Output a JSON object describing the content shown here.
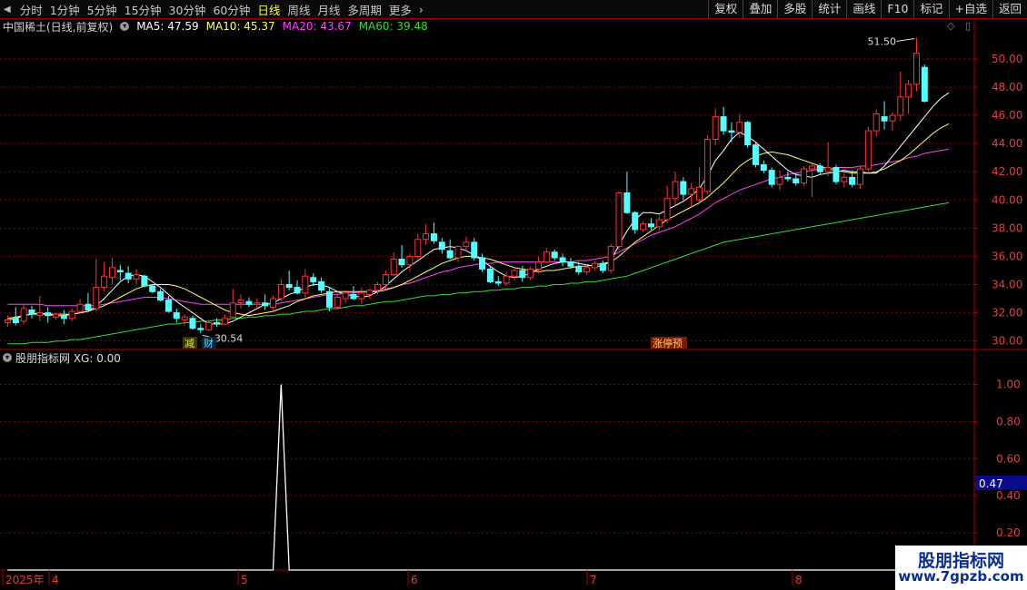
{
  "toolbar": {
    "periods": [
      "分时",
      "1分钟",
      "5分钟",
      "15分钟",
      "30分钟",
      "60分钟",
      "日线",
      "周线",
      "月线",
      "多周期",
      "更多"
    ],
    "active_period": "日线",
    "more_arrow": "›",
    "right_buttons": [
      "复权",
      "叠加",
      "多股",
      "统计",
      "画线",
      "F10",
      "标记",
      "+自选",
      "返回"
    ]
  },
  "info": {
    "stock_name": "中国稀土(日线,前复权)",
    "ma5": "MA5: 47.59",
    "ma10": "MA10: 45.37",
    "ma20": "MA20: 43.67",
    "ma60": "MA60: 39.48"
  },
  "colors": {
    "up": "#ff3232",
    "down": "#54ffff",
    "ma5": "#ffffff",
    "ma10": "#ffff66",
    "ma20": "#ff40ff",
    "ma60": "#33dd33",
    "grid": "#8a0000",
    "axis": "#b00000",
    "indicator_line": "#ffffff"
  },
  "price_chart": {
    "y_ticks": [
      "50.00",
      "48.00",
      "46.00",
      "44.00",
      "42.00",
      "40.00",
      "38.00",
      "36.00",
      "34.00",
      "32.00",
      "30.00"
    ],
    "max_label": "51.50",
    "min_label": "30.54",
    "event_tags": [
      "减",
      "财",
      "涨停预"
    ]
  },
  "indicator": {
    "title": "股朋指标网 XG: 0.00",
    "y_ticks": [
      "1.00",
      "0.80",
      "0.60",
      "0.40",
      "0.20"
    ],
    "cursor_value": "0.47"
  },
  "time_axis": {
    "labels": [
      "2025年",
      "4",
      "5",
      "6",
      "7",
      "8"
    ]
  },
  "watermark": {
    "line1": "股朋指标网",
    "line2": "www.7gpzb.com"
  },
  "chart_data": {
    "type": "candlestick",
    "title": "中国稀土(日线,前复权)",
    "ylim": [
      29.4,
      51.6
    ],
    "candles": [
      {
        "o": 31.3,
        "h": 31.8,
        "l": 31.0,
        "c": 31.5
      },
      {
        "o": 31.6,
        "h": 32.4,
        "l": 31.1,
        "c": 31.3
      },
      {
        "o": 31.4,
        "h": 32.6,
        "l": 31.2,
        "c": 32.3
      },
      {
        "o": 32.2,
        "h": 32.5,
        "l": 31.6,
        "c": 31.9
      },
      {
        "o": 31.8,
        "h": 33.2,
        "l": 31.4,
        "c": 32.0
      },
      {
        "o": 32.0,
        "h": 32.4,
        "l": 31.3,
        "c": 31.8
      },
      {
        "o": 31.7,
        "h": 32.0,
        "l": 31.5,
        "c": 31.9
      },
      {
        "o": 31.8,
        "h": 32.2,
        "l": 31.2,
        "c": 31.6
      },
      {
        "o": 31.6,
        "h": 32.3,
        "l": 31.4,
        "c": 32.1
      },
      {
        "o": 32.1,
        "h": 33.0,
        "l": 31.9,
        "c": 32.6
      },
      {
        "o": 32.6,
        "h": 33.4,
        "l": 32.4,
        "c": 32.2
      },
      {
        "o": 32.3,
        "h": 35.8,
        "l": 32.1,
        "c": 33.8
      },
      {
        "o": 33.8,
        "h": 35.6,
        "l": 33.5,
        "c": 34.6
      },
      {
        "o": 34.5,
        "h": 35.9,
        "l": 34.0,
        "c": 35.2
      },
      {
        "o": 35.0,
        "h": 35.4,
        "l": 34.3,
        "c": 34.9
      },
      {
        "o": 34.8,
        "h": 35.3,
        "l": 34.1,
        "c": 34.4
      },
      {
        "o": 34.4,
        "h": 35.1,
        "l": 34.0,
        "c": 34.7
      },
      {
        "o": 34.6,
        "h": 34.7,
        "l": 33.8,
        "c": 33.9
      },
      {
        "o": 33.9,
        "h": 34.0,
        "l": 33.4,
        "c": 33.5
      },
      {
        "o": 33.5,
        "h": 33.7,
        "l": 32.8,
        "c": 32.9
      },
      {
        "o": 32.9,
        "h": 33.2,
        "l": 32.0,
        "c": 32.1
      },
      {
        "o": 32.0,
        "h": 32.3,
        "l": 31.3,
        "c": 31.6
      },
      {
        "o": 31.5,
        "h": 31.9,
        "l": 31.1,
        "c": 31.7
      },
      {
        "o": 31.6,
        "h": 31.8,
        "l": 30.8,
        "c": 30.9
      },
      {
        "o": 30.9,
        "h": 31.2,
        "l": 30.54,
        "c": 30.8
      },
      {
        "o": 30.8,
        "h": 31.5,
        "l": 30.7,
        "c": 31.3
      },
      {
        "o": 31.3,
        "h": 31.6,
        "l": 31.0,
        "c": 31.2
      },
      {
        "o": 31.2,
        "h": 31.9,
        "l": 31.1,
        "c": 31.6
      },
      {
        "o": 31.7,
        "h": 33.7,
        "l": 31.7,
        "c": 32.7
      },
      {
        "o": 32.7,
        "h": 33.3,
        "l": 32.3,
        "c": 32.9
      },
      {
        "o": 32.8,
        "h": 33.1,
        "l": 32.4,
        "c": 32.6
      },
      {
        "o": 32.6,
        "h": 33.0,
        "l": 32.3,
        "c": 32.7
      },
      {
        "o": 32.7,
        "h": 33.3,
        "l": 32.2,
        "c": 32.5
      },
      {
        "o": 32.4,
        "h": 33.2,
        "l": 32.2,
        "c": 33.0
      },
      {
        "o": 33.0,
        "h": 34.4,
        "l": 32.8,
        "c": 34.0
      },
      {
        "o": 34.0,
        "h": 35.0,
        "l": 33.6,
        "c": 33.8
      },
      {
        "o": 33.8,
        "h": 34.3,
        "l": 33.3,
        "c": 33.4
      },
      {
        "o": 33.4,
        "h": 35.1,
        "l": 33.1,
        "c": 34.6
      },
      {
        "o": 34.5,
        "h": 34.8,
        "l": 33.9,
        "c": 34.2
      },
      {
        "o": 34.2,
        "h": 34.5,
        "l": 33.4,
        "c": 33.6
      },
      {
        "o": 33.5,
        "h": 33.8,
        "l": 32.1,
        "c": 32.4
      },
      {
        "o": 32.4,
        "h": 33.5,
        "l": 32.2,
        "c": 33.1
      },
      {
        "o": 33.0,
        "h": 33.6,
        "l": 32.7,
        "c": 33.4
      },
      {
        "o": 33.3,
        "h": 33.9,
        "l": 32.9,
        "c": 33.0
      },
      {
        "o": 33.0,
        "h": 33.8,
        "l": 32.6,
        "c": 33.4
      },
      {
        "o": 33.3,
        "h": 33.7,
        "l": 33.0,
        "c": 33.6
      },
      {
        "o": 33.6,
        "h": 34.2,
        "l": 33.3,
        "c": 34.0
      },
      {
        "o": 34.0,
        "h": 35.0,
        "l": 33.7,
        "c": 34.7
      },
      {
        "o": 34.7,
        "h": 36.3,
        "l": 34.6,
        "c": 35.8
      },
      {
        "o": 35.8,
        "h": 36.8,
        "l": 35.2,
        "c": 35.4
      },
      {
        "o": 35.4,
        "h": 36.2,
        "l": 34.9,
        "c": 36.0
      },
      {
        "o": 36.0,
        "h": 37.6,
        "l": 35.8,
        "c": 37.2
      },
      {
        "o": 37.2,
        "h": 38.3,
        "l": 36.8,
        "c": 37.6
      },
      {
        "o": 37.6,
        "h": 38.4,
        "l": 36.9,
        "c": 37.1
      },
      {
        "o": 37.0,
        "h": 37.3,
        "l": 36.2,
        "c": 36.5
      },
      {
        "o": 36.4,
        "h": 37.2,
        "l": 35.8,
        "c": 35.9
      },
      {
        "o": 35.9,
        "h": 36.8,
        "l": 35.6,
        "c": 36.7
      },
      {
        "o": 36.7,
        "h": 37.4,
        "l": 36.4,
        "c": 37.0
      },
      {
        "o": 37.0,
        "h": 37.3,
        "l": 35.7,
        "c": 35.9
      },
      {
        "o": 35.9,
        "h": 36.2,
        "l": 34.9,
        "c": 35.1
      },
      {
        "o": 35.1,
        "h": 35.3,
        "l": 34.1,
        "c": 34.2
      },
      {
        "o": 34.2,
        "h": 34.6,
        "l": 33.9,
        "c": 34.1
      },
      {
        "o": 34.1,
        "h": 34.9,
        "l": 33.9,
        "c": 34.6
      },
      {
        "o": 34.6,
        "h": 35.3,
        "l": 34.3,
        "c": 35.0
      },
      {
        "o": 35.0,
        "h": 35.3,
        "l": 34.2,
        "c": 34.5
      },
      {
        "o": 34.5,
        "h": 35.3,
        "l": 34.3,
        "c": 35.1
      },
      {
        "o": 35.1,
        "h": 36.0,
        "l": 34.8,
        "c": 35.6
      },
      {
        "o": 35.6,
        "h": 36.6,
        "l": 35.5,
        "c": 36.3
      },
      {
        "o": 36.3,
        "h": 36.5,
        "l": 35.7,
        "c": 35.9
      },
      {
        "o": 35.9,
        "h": 36.2,
        "l": 35.3,
        "c": 35.6
      },
      {
        "o": 35.6,
        "h": 35.9,
        "l": 35.1,
        "c": 35.3
      },
      {
        "o": 35.3,
        "h": 35.6,
        "l": 34.7,
        "c": 34.9
      },
      {
        "o": 34.9,
        "h": 35.4,
        "l": 34.7,
        "c": 35.2
      },
      {
        "o": 35.2,
        "h": 35.7,
        "l": 35.0,
        "c": 35.5
      },
      {
        "o": 35.5,
        "h": 35.7,
        "l": 34.8,
        "c": 35.0
      },
      {
        "o": 35.0,
        "h": 36.9,
        "l": 34.8,
        "c": 36.7
      },
      {
        "o": 36.7,
        "h": 40.6,
        "l": 36.4,
        "c": 40.5
      },
      {
        "o": 40.5,
        "h": 42.0,
        "l": 39.0,
        "c": 39.1
      },
      {
        "o": 39.1,
        "h": 39.2,
        "l": 37.6,
        "c": 37.9
      },
      {
        "o": 37.9,
        "h": 38.5,
        "l": 37.7,
        "c": 38.3
      },
      {
        "o": 38.3,
        "h": 38.7,
        "l": 37.9,
        "c": 38.1
      },
      {
        "o": 38.1,
        "h": 38.9,
        "l": 37.8,
        "c": 38.6
      },
      {
        "o": 38.6,
        "h": 41.0,
        "l": 38.4,
        "c": 40.1
      },
      {
        "o": 40.1,
        "h": 42.0,
        "l": 39.6,
        "c": 41.3
      },
      {
        "o": 41.3,
        "h": 41.6,
        "l": 40.0,
        "c": 40.4
      },
      {
        "o": 40.4,
        "h": 41.2,
        "l": 39.5,
        "c": 40.8
      },
      {
        "o": 40.0,
        "h": 42.3,
        "l": 39.7,
        "c": 40.9
      },
      {
        "o": 40.6,
        "h": 44.6,
        "l": 40.4,
        "c": 44.3
      },
      {
        "o": 44.3,
        "h": 46.5,
        "l": 43.9,
        "c": 45.9
      },
      {
        "o": 45.9,
        "h": 46.6,
        "l": 44.6,
        "c": 44.9
      },
      {
        "o": 44.9,
        "h": 45.5,
        "l": 44.1,
        "c": 44.8
      },
      {
        "o": 44.8,
        "h": 46.1,
        "l": 44.4,
        "c": 45.5
      },
      {
        "o": 45.5,
        "h": 45.6,
        "l": 43.7,
        "c": 43.9
      },
      {
        "o": 43.9,
        "h": 44.1,
        "l": 42.3,
        "c": 42.5
      },
      {
        "o": 42.5,
        "h": 42.8,
        "l": 41.9,
        "c": 42.1
      },
      {
        "o": 42.1,
        "h": 42.3,
        "l": 40.9,
        "c": 41.1
      },
      {
        "o": 41.1,
        "h": 42.1,
        "l": 40.7,
        "c": 41.6
      },
      {
        "o": 41.6,
        "h": 42.0,
        "l": 41.3,
        "c": 41.5
      },
      {
        "o": 41.5,
        "h": 41.9,
        "l": 41.0,
        "c": 41.2
      },
      {
        "o": 41.2,
        "h": 42.4,
        "l": 41.0,
        "c": 42.2
      },
      {
        "o": 42.2,
        "h": 42.6,
        "l": 40.2,
        "c": 42.4
      },
      {
        "o": 42.4,
        "h": 42.6,
        "l": 41.8,
        "c": 42.0
      },
      {
        "o": 42.0,
        "h": 44.1,
        "l": 41.7,
        "c": 42.3
      },
      {
        "o": 42.3,
        "h": 42.5,
        "l": 41.1,
        "c": 41.3
      },
      {
        "o": 41.3,
        "h": 41.9,
        "l": 40.9,
        "c": 41.6
      },
      {
        "o": 41.6,
        "h": 42.1,
        "l": 40.9,
        "c": 41.1
      },
      {
        "o": 41.1,
        "h": 42.4,
        "l": 40.8,
        "c": 42.2
      },
      {
        "o": 42.2,
        "h": 45.2,
        "l": 41.9,
        "c": 44.9
      },
      {
        "o": 44.9,
        "h": 46.4,
        "l": 44.5,
        "c": 46.1
      },
      {
        "o": 45.9,
        "h": 47.0,
        "l": 45.0,
        "c": 45.6
      },
      {
        "o": 45.6,
        "h": 46.2,
        "l": 44.9,
        "c": 46.0
      },
      {
        "o": 46.0,
        "h": 49.1,
        "l": 45.6,
        "c": 47.3
      },
      {
        "o": 47.3,
        "h": 48.5,
        "l": 46.1,
        "c": 48.2
      },
      {
        "o": 48.2,
        "h": 51.5,
        "l": 47.7,
        "c": 50.4
      },
      {
        "o": 49.4,
        "h": 49.6,
        "l": 46.9,
        "c": 47.0
      }
    ],
    "ma5": [
      31.5,
      31.6,
      31.8,
      31.9,
      32.0,
      31.9,
      31.8,
      31.8,
      31.9,
      32.0,
      32.1,
      32.5,
      33.0,
      33.6,
      34.2,
      34.6,
      34.7,
      34.6,
      34.2,
      33.8,
      33.3,
      32.8,
      32.4,
      32.0,
      31.6,
      31.2,
      31.2,
      31.2,
      31.4,
      31.7,
      32.0,
      32.3,
      32.6,
      32.7,
      33.0,
      33.3,
      33.5,
      33.8,
      34.0,
      34.0,
      33.8,
      33.5,
      33.3,
      33.2,
      33.1,
      33.2,
      33.5,
      33.9,
      34.4,
      34.9,
      35.3,
      35.7,
      36.1,
      36.5,
      36.6,
      36.7,
      36.6,
      36.4,
      36.1,
      35.7,
      35.3,
      34.9,
      34.6,
      34.5,
      34.6,
      34.8,
      35.1,
      35.3,
      35.5,
      35.6,
      35.6,
      35.5,
      35.4,
      35.3,
      35.3,
      35.7,
      36.8,
      37.8,
      38.6,
      39.1,
      39.1,
      39.0,
      39.3,
      39.6,
      39.9,
      40.3,
      40.8,
      41.7,
      42.8,
      43.5,
      44.3,
      44.8,
      44.5,
      44.1,
      43.6,
      43.1,
      42.6,
      42.1,
      41.8,
      41.7,
      41.6,
      41.8,
      41.9,
      42.0,
      42.1,
      42.0,
      42.0,
      41.9,
      41.9,
      42.4,
      43.1,
      43.8,
      44.5,
      45.2,
      45.9,
      46.6,
      47.2,
      47.6
    ],
    "ma10": [
      31.6,
      31.7,
      31.8,
      31.9,
      31.9,
      31.9,
      31.9,
      31.9,
      31.9,
      32.0,
      32.1,
      32.3,
      32.5,
      32.8,
      33.1,
      33.4,
      33.7,
      33.9,
      34.0,
      34.0,
      34.0,
      33.9,
      33.7,
      33.4,
      33.1,
      32.8,
      32.5,
      32.2,
      32.0,
      31.9,
      31.8,
      31.9,
      32.0,
      32.1,
      32.3,
      32.5,
      32.8,
      33.0,
      33.2,
      33.3,
      33.4,
      33.5,
      33.5,
      33.5,
      33.5,
      33.5,
      33.5,
      33.6,
      33.8,
      34.0,
      34.3,
      34.6,
      34.9,
      35.2,
      35.5,
      35.7,
      35.9,
      36.0,
      36.0,
      35.9,
      35.8,
      35.6,
      35.4,
      35.2,
      35.1,
      35.0,
      34.9,
      35.0,
      35.0,
      35.1,
      35.2,
      35.3,
      35.3,
      35.4,
      35.5,
      35.6,
      36.0,
      36.5,
      37.0,
      37.4,
      37.8,
      38.2,
      38.6,
      38.9,
      39.2,
      39.5,
      39.8,
      40.2,
      40.7,
      41.2,
      41.8,
      42.4,
      42.8,
      43.1,
      43.3,
      43.4,
      43.3,
      43.2,
      43.0,
      42.8,
      42.6,
      42.4,
      42.2,
      42.1,
      42.0,
      41.9,
      41.9,
      41.9,
      42.0,
      42.2,
      42.5,
      42.8,
      43.2,
      43.7,
      44.2,
      44.7,
      45.1,
      45.4
    ],
    "ma20": [
      32.6,
      32.6,
      32.6,
      32.6,
      32.6,
      32.5,
      32.5,
      32.5,
      32.5,
      32.5,
      32.5,
      32.5,
      32.6,
      32.7,
      32.8,
      32.9,
      33.0,
      33.1,
      33.1,
      33.1,
      33.0,
      32.9,
      32.8,
      32.7,
      32.6,
      32.6,
      32.6,
      32.6,
      32.6,
      32.6,
      32.6,
      32.6,
      32.6,
      32.6,
      32.7,
      32.8,
      32.9,
      33.0,
      33.1,
      33.2,
      33.3,
      33.3,
      33.4,
      33.4,
      33.5,
      33.5,
      33.6,
      33.7,
      33.8,
      34.0,
      34.1,
      34.3,
      34.5,
      34.7,
      34.9,
      35.0,
      35.2,
      35.3,
      35.4,
      35.5,
      35.5,
      35.6,
      35.6,
      35.6,
      35.6,
      35.6,
      35.6,
      35.6,
      35.6,
      35.6,
      35.6,
      35.7,
      35.7,
      35.8,
      35.9,
      36.0,
      36.3,
      36.6,
      36.9,
      37.2,
      37.5,
      37.7,
      37.9,
      38.1,
      38.4,
      38.7,
      39.0,
      39.4,
      39.8,
      40.1,
      40.4,
      40.7,
      40.9,
      41.1,
      41.3,
      41.5,
      41.6,
      41.8,
      41.9,
      42.0,
      42.1,
      42.2,
      42.2,
      42.3,
      42.3,
      42.3,
      42.4,
      42.4,
      42.5,
      42.6,
      42.7,
      42.8,
      43.0,
      43.1,
      43.3,
      43.4,
      43.5,
      43.6
    ],
    "ma60": [
      29.8,
      29.8,
      29.8,
      29.9,
      29.9,
      29.9,
      30.0,
      30.0,
      30.1,
      30.1,
      30.2,
      30.3,
      30.4,
      30.5,
      30.6,
      30.7,
      30.8,
      30.9,
      31.0,
      31.1,
      31.2,
      31.2,
      31.3,
      31.3,
      31.4,
      31.4,
      31.5,
      31.5,
      31.6,
      31.6,
      31.7,
      31.7,
      31.8,
      31.8,
      31.9,
      31.9,
      32.0,
      32.1,
      32.1,
      32.2,
      32.3,
      32.3,
      32.4,
      32.5,
      32.5,
      32.6,
      32.7,
      32.8,
      32.8,
      32.9,
      33.0,
      33.1,
      33.2,
      33.2,
      33.3,
      33.3,
      33.4,
      33.4,
      33.5,
      33.5,
      33.6,
      33.6,
      33.7,
      33.7,
      33.8,
      33.8,
      33.9,
      33.9,
      34.0,
      34.0,
      34.1,
      34.1,
      34.2,
      34.2,
      34.3,
      34.4,
      34.5,
      34.6,
      34.8,
      35.0,
      35.2,
      35.4,
      35.6,
      35.8,
      36.0,
      36.2,
      36.4,
      36.6,
      36.8,
      37.0,
      37.1,
      37.2,
      37.3,
      37.4,
      37.5,
      37.6,
      37.7,
      37.8,
      37.9,
      38.0,
      38.1,
      38.2,
      38.3,
      38.4,
      38.5,
      38.6,
      38.7,
      38.8,
      38.9,
      39.0,
      39.1,
      39.2,
      39.3,
      39.4,
      39.5,
      39.6,
      39.7,
      39.8
    ]
  },
  "indicator_data": {
    "type": "line",
    "ylim": [
      0.0,
      1.1
    ],
    "spike_index": 34,
    "spike_value": 1.0,
    "baseline": 0.0
  }
}
